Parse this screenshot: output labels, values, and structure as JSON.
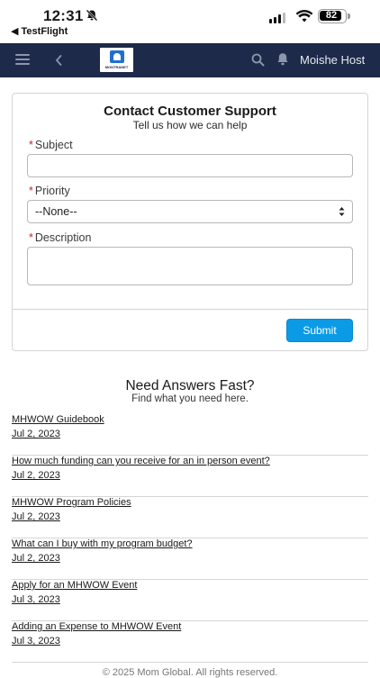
{
  "status_bar": {
    "time": "12:31",
    "back_app": "◀ TestFlight",
    "battery": "82"
  },
  "nav": {
    "logo_text": "MONTRANET",
    "user_name": "Moishe Host"
  },
  "contact": {
    "title": "Contact Customer Support",
    "subtitle": "Tell us how we can help",
    "required_mark": "*",
    "subject_label": "Subject",
    "subject_value": "",
    "priority_label": "Priority",
    "priority_value": "--None--",
    "description_label": "Description",
    "description_value": "",
    "submit_label": "Submit"
  },
  "faq": {
    "title": "Need Answers Fast?",
    "subtitle": "Find what you need here.",
    "items": [
      {
        "question": "MHWOW Guidebook",
        "date": "Jul 2, 2023"
      },
      {
        "question": "How much funding can you receive for an in person event?",
        "date": "Jul 2, 2023"
      },
      {
        "question": "MHWOW Program Policies",
        "date": "Jul 2, 2023"
      },
      {
        "question": "What can I buy with my program budget?",
        "date": "Jul 2, 2023"
      },
      {
        "question": "Apply for an MHWOW Event",
        "date": "Jul 3, 2023"
      },
      {
        "question": "Adding an Expense to MHWOW Event",
        "date": "Jul 3, 2023"
      }
    ]
  },
  "footer": "© 2025 Mom Global. All rights reserved.",
  "colors": {
    "nav_bg": "#1d2a4a",
    "accent": "#0b9be6",
    "required": "#c0262d"
  }
}
